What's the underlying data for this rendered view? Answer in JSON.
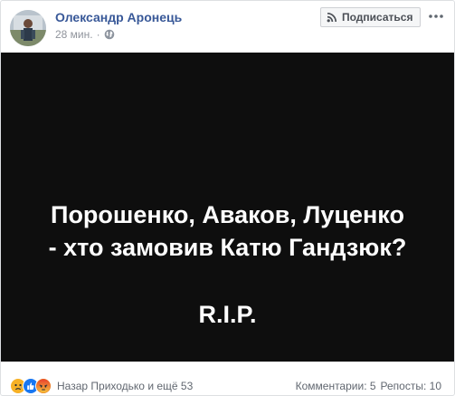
{
  "post": {
    "author": "Олександр Аронець",
    "time": "28 мин.",
    "separator": "·",
    "subscribe_label": "Подписаться",
    "image_text": {
      "line1": "Порошенко, Аваков, Луценко",
      "line2": "- хто замовив Катю Гандзюк?",
      "line3": "R.I.P."
    }
  },
  "footer": {
    "reaction_icons": [
      "sad-reaction-icon",
      "like-reaction-icon",
      "angry-reaction-icon"
    ],
    "reactors_text": "Назар Приходько и ещё 53",
    "comments": "Комментарии: 5",
    "shares": "Репосты: 10"
  },
  "colors": {
    "author_link": "#385898",
    "meta_gray": "#90949c",
    "image_bg": "#0e0e0e",
    "like_blue": "#1877f2",
    "angry_orange": "#e9710f",
    "sad_yellow": "#f7b125"
  }
}
